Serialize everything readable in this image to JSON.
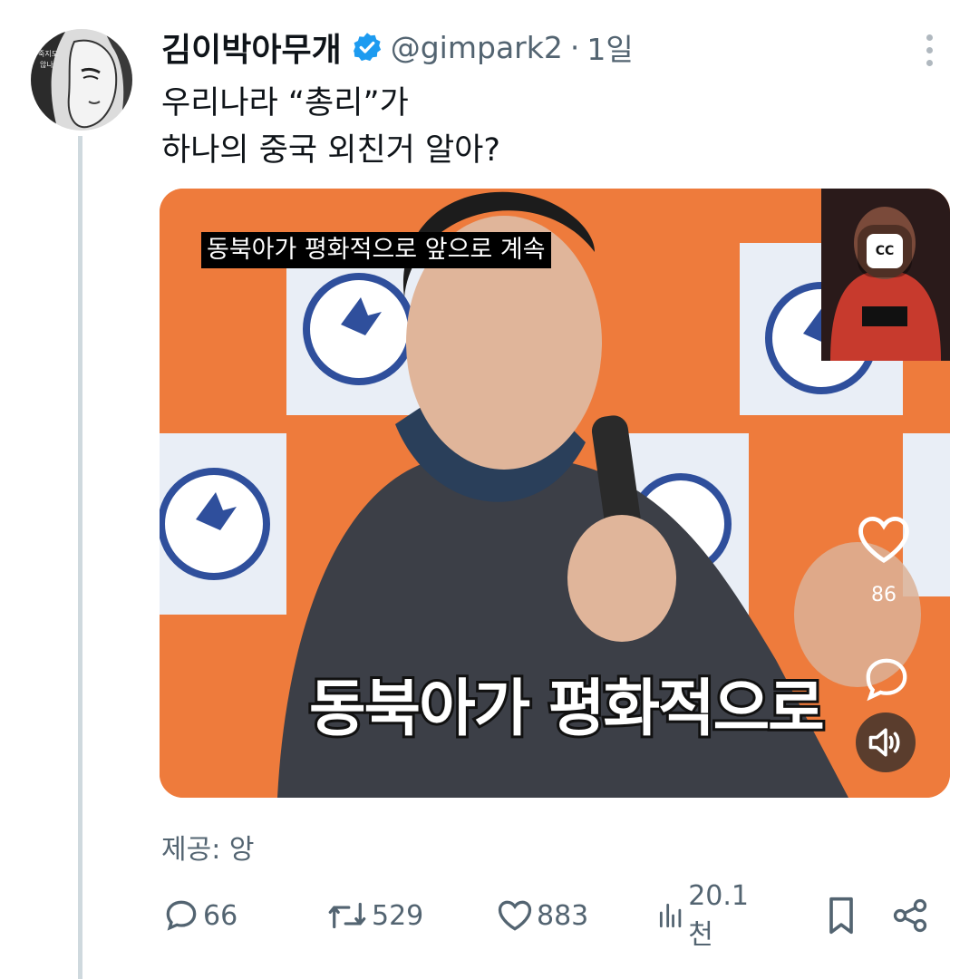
{
  "author": {
    "display_name": "김이박아무개",
    "handle": "@gimpark2",
    "separator": "·",
    "time": "1일",
    "avatar_icon": "illustrated-woman-avatar",
    "verified_icon": "verified-badge-icon"
  },
  "tweet": {
    "lines": [
      "우리나라 “총리”가",
      "하나의 중국 외친거 알아?"
    ]
  },
  "video": {
    "overlay_caption": "동북아가 평화적으로 앞으로 계속",
    "burned_caption": "동북아가 평화적으로",
    "cc_label": "CC",
    "like_count": "86",
    "controls": [
      "heart-icon",
      "comment-icon",
      "speaker-icon"
    ]
  },
  "source": "제공: 앙",
  "actions": {
    "replies": "66",
    "retweets": "529",
    "likes": "883",
    "views": "20.1천"
  },
  "colors": {
    "accent_verified": "#1d9bf0",
    "text": "#0f1419",
    "secondary": "#536471",
    "video_orange": "#ef7a3a"
  }
}
